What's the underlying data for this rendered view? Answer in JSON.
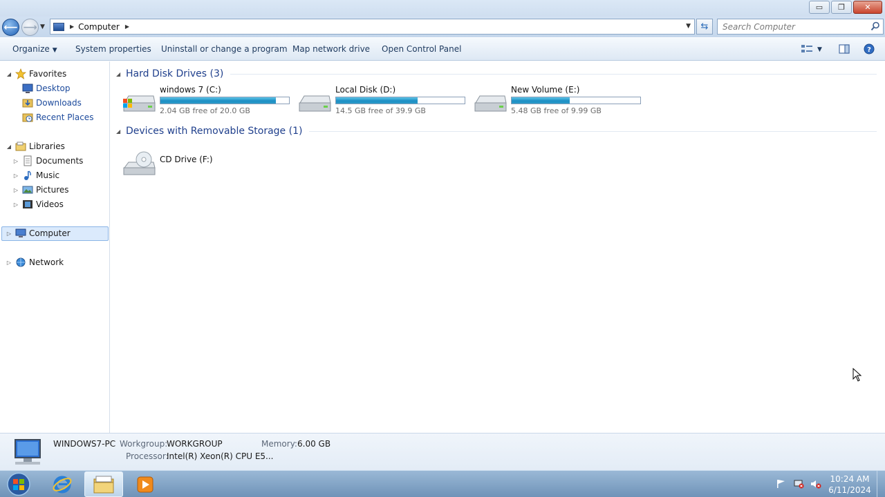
{
  "window": {
    "minimize_glyph": "▭",
    "maximize_glyph": "❐",
    "close_glyph": "✕"
  },
  "address": {
    "breadcrumb": [
      "Computer"
    ],
    "search_placeholder": "Search Computer"
  },
  "commands": {
    "organize": "Organize",
    "system_properties": "System properties",
    "uninstall": "Uninstall or change a program",
    "map_drive": "Map network drive",
    "control_panel": "Open Control Panel"
  },
  "sidebar": {
    "favorites": "Favorites",
    "desktop": "Desktop",
    "downloads": "Downloads",
    "recent_places": "Recent Places",
    "libraries": "Libraries",
    "documents": "Documents",
    "music": "Music",
    "pictures": "Pictures",
    "videos": "Videos",
    "computer": "Computer",
    "network": "Network"
  },
  "groups": {
    "hard_disks": "Hard Disk Drives (3)",
    "removable": "Devices with Removable Storage (1)"
  },
  "drives": [
    {
      "name": "windows 7 (C:)",
      "free": "2.04 GB free of 20.0 GB",
      "used_fraction": 0.898
    },
    {
      "name": "Local Disk (D:)",
      "free": "14.5 GB free of 39.9 GB",
      "used_fraction": 0.637
    },
    {
      "name": "New Volume (E:)",
      "free": "5.48 GB free of 9.99 GB",
      "used_fraction": 0.451
    }
  ],
  "removable": [
    {
      "name": "CD Drive (F:)"
    }
  ],
  "details": {
    "computer_name": "WINDOWS7-PC",
    "workgroup_label": "Workgroup:",
    "workgroup_value": "WORKGROUP",
    "memory_label": "Memory:",
    "memory_value": "6.00 GB",
    "processor_label": "Processor:",
    "processor_value": "Intel(R) Xeon(R) CPU E5..."
  },
  "taskbar": {
    "time": "10:24 AM",
    "date": "6/11/2024"
  },
  "colors": {
    "accent": "#1f3f8c",
    "drive_bar": "#1d8fc4",
    "selection": "#dbeafc"
  }
}
